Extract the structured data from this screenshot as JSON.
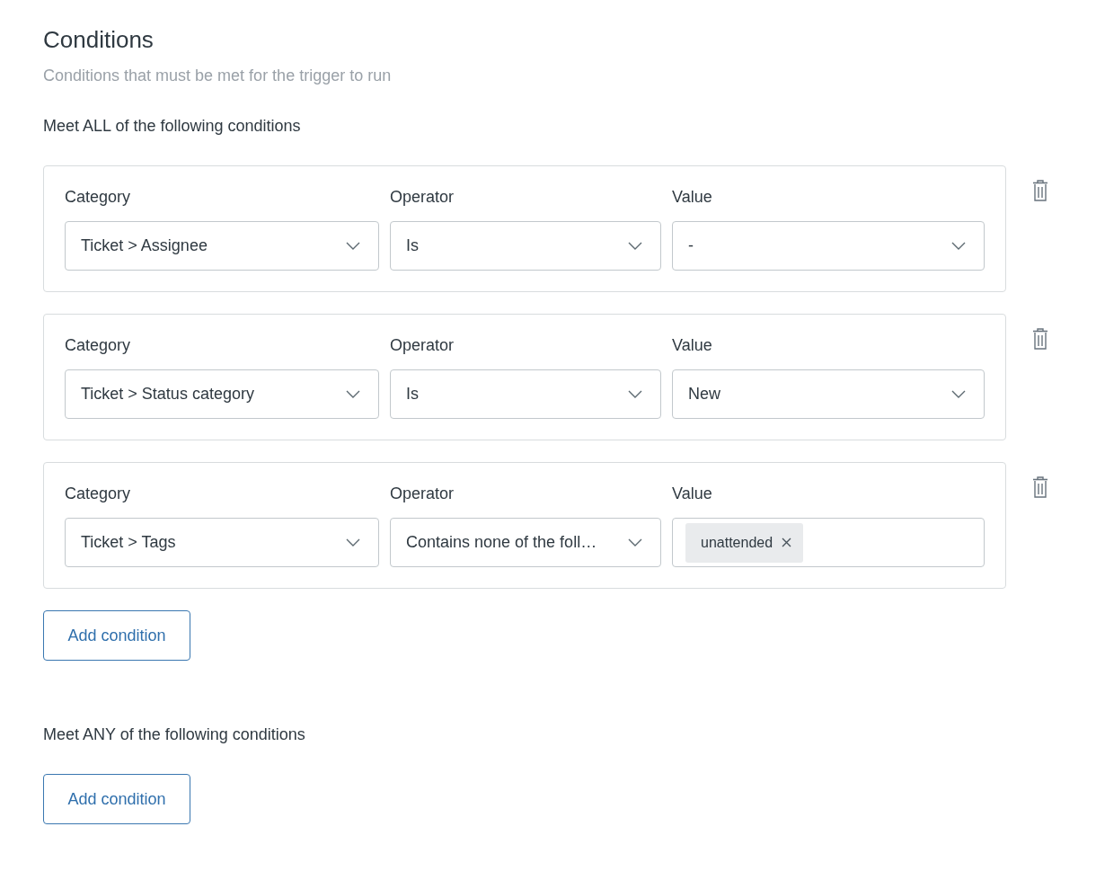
{
  "header": {
    "title": "Conditions",
    "subtitle": "Conditions that must be met for the trigger to run"
  },
  "groups": [
    {
      "heading": "Meet ALL of the following conditions",
      "conditions": [
        {
          "category_label": "Category",
          "category": "Ticket > Assignee",
          "operator_label": "Operator",
          "operator": "Is",
          "value_label": "Value",
          "value": {
            "kind": "select",
            "text": "-"
          }
        },
        {
          "category_label": "Category",
          "category": "Ticket > Status category",
          "operator_label": "Operator",
          "operator": "Is",
          "value_label": "Value",
          "value": {
            "kind": "select",
            "text": "New"
          }
        },
        {
          "category_label": "Category",
          "category": "Ticket > Tags",
          "operator_label": "Operator",
          "operator": "Contains none of the foll…",
          "value_label": "Value",
          "value": {
            "kind": "tags",
            "tags": [
              "unattended"
            ]
          }
        }
      ],
      "add_button": "Add condition"
    },
    {
      "heading": "Meet ANY of the following conditions",
      "add_button": "Add condition"
    }
  ]
}
